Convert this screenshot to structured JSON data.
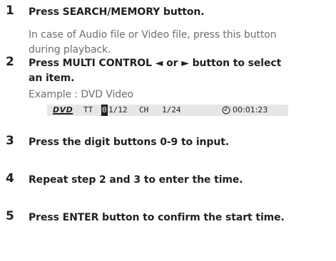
{
  "steps": [
    {
      "number": "1",
      "title": "Press SEARCH/MEMORY button.",
      "note_line1": "In case of Audio file or Video file, press this button",
      "note_line2": "during playback."
    },
    {
      "number": "2",
      "title_line1": "Press MULTI CONTROL ◄ or ► button to select",
      "title_line2": "an item.",
      "example": "Example : DVD Video"
    },
    {
      "number": "3",
      "title": "Press the digit buttons 0-9 to input."
    },
    {
      "number": "4",
      "title": "Repeat step 2 and 3 to enter the time."
    },
    {
      "number": "5",
      "title": "Press ENTER button to confirm the start time."
    }
  ],
  "display": {
    "logo": "DVD",
    "tt_label": "TT",
    "tt_cursor_digit": "0",
    "tt_value_rest": "1/12",
    "ch_label": "CH",
    "ch_value": "1/24",
    "time": "00:01:23",
    "time_icon": "clock-icon",
    "background_color": "#e6e6e6"
  }
}
